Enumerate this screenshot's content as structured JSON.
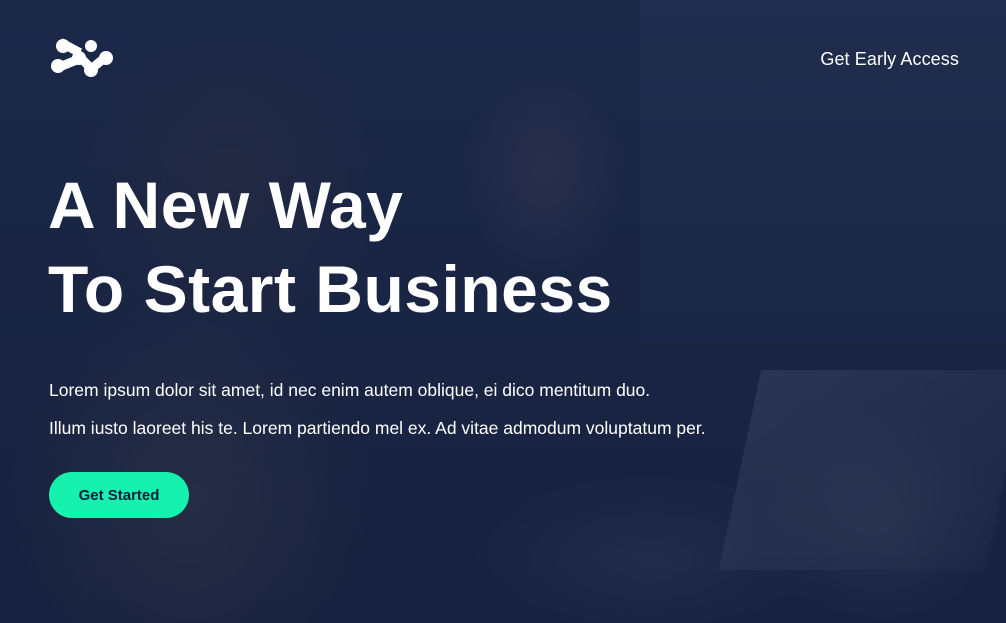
{
  "nav": {
    "cta_label": "Get Early Access"
  },
  "hero": {
    "title_lines": [
      "A New Way",
      "To Start Business"
    ],
    "text_lines": [
      "Lorem ipsum dolor sit amet, id nec enim autem oblique, ei dico mentitum duo.",
      "Illum iusto laoreet his te. Lorem partiendo mel ex. Ad vitae admodum voluptatum per."
    ],
    "button_label": "Get Started"
  },
  "colors": {
    "background_overlay": "#1b2541",
    "accent": "#16f2ae",
    "text": "#ffffff"
  },
  "icons": {
    "logo": "brand-logo-icon"
  }
}
